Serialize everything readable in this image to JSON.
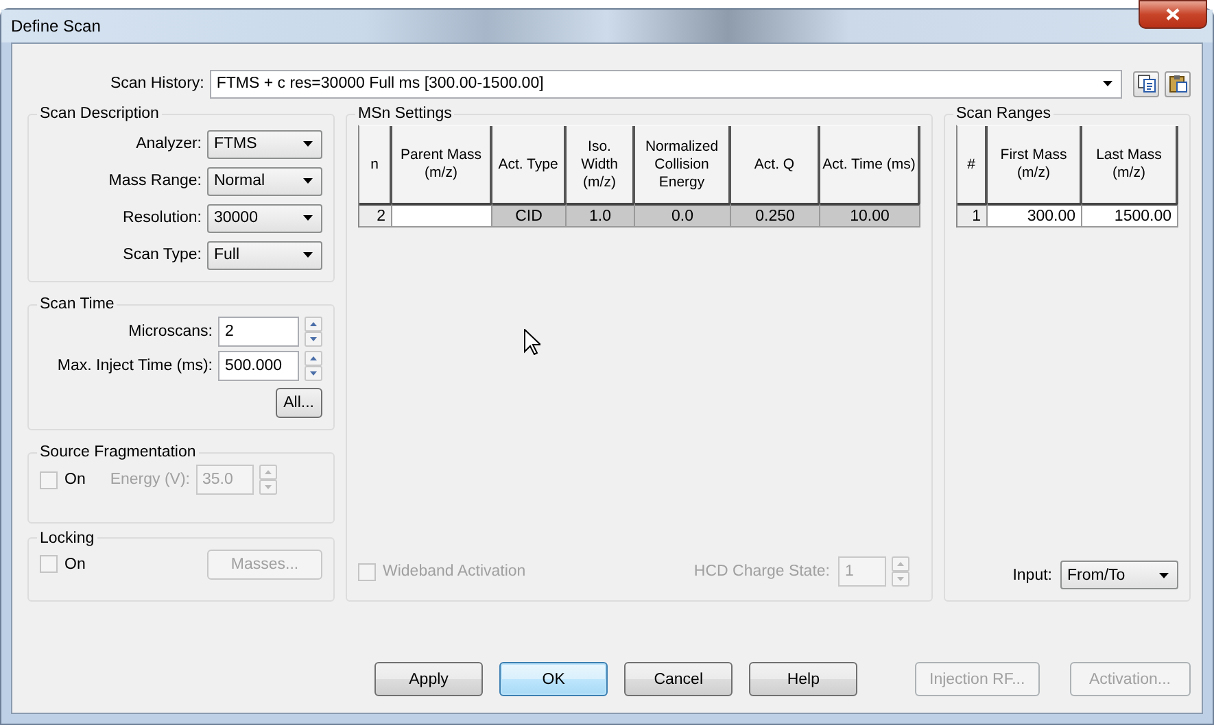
{
  "window": {
    "title": "Define Scan"
  },
  "scan_history": {
    "label": "Scan History:",
    "value": "FTMS + c res=30000 Full ms [300.00-1500.00]"
  },
  "scan_description": {
    "title": "Scan Description",
    "fields": [
      {
        "label": "Analyzer:",
        "value": "FTMS"
      },
      {
        "label": "Mass Range:",
        "value": "Normal"
      },
      {
        "label": "Resolution:",
        "value": "30000"
      },
      {
        "label": "Scan Type:",
        "value": "Full"
      }
    ]
  },
  "scan_time": {
    "title": "Scan Time",
    "fields": [
      {
        "label": "Microscans:",
        "value": "2"
      },
      {
        "label": "Max. Inject Time (ms):",
        "value": "500.000"
      }
    ],
    "button": "All..."
  },
  "source_fragmentation": {
    "title": "Source Fragmentation",
    "checkbox": {
      "label": "On",
      "checked": false
    },
    "energy": {
      "label": "Energy (V):",
      "value": "35.0",
      "disabled": true
    }
  },
  "locking": {
    "title": "Locking",
    "checkbox": {
      "label": "On",
      "checked": false
    },
    "button": {
      "label": "Masses...",
      "disabled": true
    }
  },
  "msn_settings": {
    "title": "MSn Settings",
    "table": {
      "columns": [
        "n",
        "Parent Mass (m/z)",
        "Act. Type",
        "Iso. Width (m/z)",
        "Normalized Collision Energy",
        "Act. Q",
        "Act. Time (ms)"
      ],
      "rows": [
        {
          "cells": [
            {
              "text": "2"
            },
            {
              "editable": true
            },
            {
              "text": "CID",
              "editable": false
            },
            {
              "text": "1.0",
              "editable": false
            },
            {
              "text": "0.0",
              "editable": false
            },
            {
              "text": "0.250",
              "editable": false
            },
            {
              "text": "10.00",
              "editable": false
            }
          ]
        }
      ]
    },
    "wideband": {
      "label": "Wideband Activation",
      "checked": false,
      "disabled": true
    },
    "hcd_charge_state": {
      "label": "HCD Charge State:",
      "value": "1",
      "disabled": true
    }
  },
  "scan_ranges": {
    "title": "Scan Ranges",
    "table": {
      "columns": [
        "#",
        "First Mass (m/z)",
        "Last Mass (m/z)"
      ],
      "rows": [
        {
          "cells": [
            {
              "text": "1"
            },
            {
              "text": "300.00",
              "editable": true
            },
            {
              "text": "1500.00",
              "editable": true
            }
          ]
        }
      ]
    },
    "input": {
      "label": "Input:",
      "value": "From/To"
    }
  },
  "buttons": [
    {
      "label": "Apply",
      "disabled": false,
      "default": false
    },
    {
      "label": "OK",
      "disabled": false,
      "default": true
    },
    {
      "label": "Cancel",
      "disabled": false,
      "default": false
    },
    {
      "label": "Help",
      "disabled": false,
      "default": false
    },
    {
      "label": "Injection RF...",
      "disabled": true,
      "default": false
    },
    {
      "label": "Activation...",
      "disabled": true,
      "default": false
    }
  ]
}
